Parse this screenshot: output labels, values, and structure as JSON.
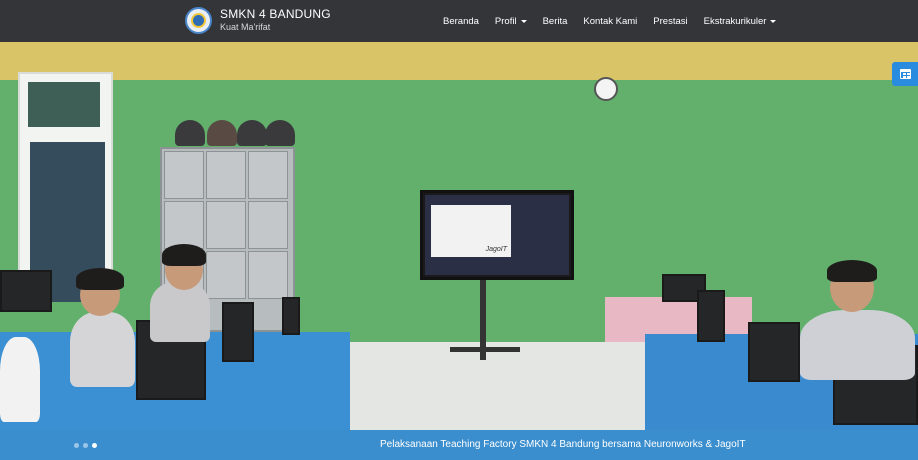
{
  "brand": {
    "name": "SMKN 4 BANDUNG",
    "tagline": "Kuat Ma'rifat"
  },
  "nav": {
    "items": [
      {
        "label": "Beranda",
        "dropdown": false
      },
      {
        "label": "Profil",
        "dropdown": true
      },
      {
        "label": "Berita",
        "dropdown": false
      },
      {
        "label": "Kontak Kami",
        "dropdown": false
      },
      {
        "label": "Prestasi",
        "dropdown": false
      },
      {
        "label": "Ekstrakurikuler",
        "dropdown": true
      }
    ]
  },
  "hero": {
    "caption": "Pelaksanaan Teaching Factory SMKN 4 Bandung bersama Neuronworks & JagoIT",
    "slide_count": 3,
    "active_slide": 3,
    "tv_brand_text": "JagoIT"
  },
  "icons": {
    "calendar": "calendar-icon",
    "caret": "caret-down-icon"
  },
  "colors": {
    "navbar": "#333539",
    "caption_bar": "#3a8ece",
    "calendar_button": "#2a8cde"
  }
}
